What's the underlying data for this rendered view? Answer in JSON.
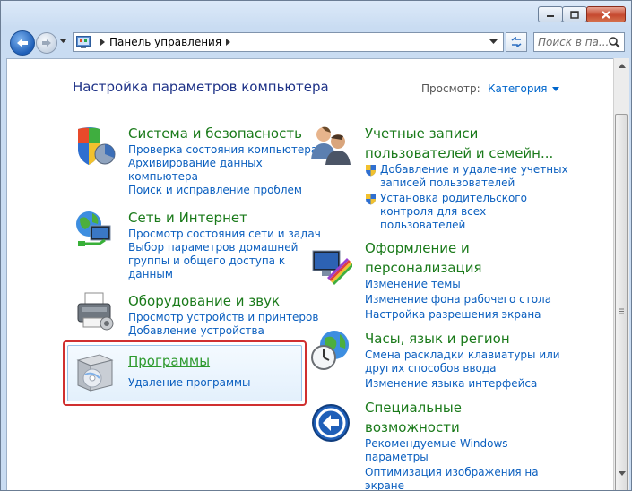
{
  "window": {
    "caption": {
      "minimize": "minimize",
      "maximize": "maximize",
      "close": "close"
    }
  },
  "toolbar": {
    "breadcrumb": "Панель управления",
    "search_placeholder": "Поиск в па..."
  },
  "header": {
    "title": "Настройка параметров компьютера",
    "view_by_label": "Просмотр:",
    "view_by_value": "Категория"
  },
  "left_categories": [
    {
      "title": "Система и безопасность",
      "links": [
        "Проверка состояния компьютера",
        "Архивирование данных",
        "компьютера",
        "Поиск и исправление проблем"
      ]
    },
    {
      "title": "Сеть и Интернет",
      "links": [
        "Просмотр состояния сети и задач",
        "Выбор параметров домашней",
        "группы и общего доступа к",
        "данным"
      ]
    },
    {
      "title": "Оборудование и звук",
      "links": [
        "Просмотр устройств и принтеров",
        "Добавление устройства"
      ]
    },
    {
      "title": "Программы",
      "links": [
        "Удаление программы"
      ]
    }
  ],
  "right_categories": [
    {
      "title_lines": [
        "Учетные записи",
        "пользователей и семейн..."
      ],
      "links": [
        "Добавление и удаление учетных",
        "записей пользователей",
        "Установка родительского",
        "контроля для всех",
        "пользователей"
      ]
    },
    {
      "title_lines": [
        "Оформление и",
        "персонализация"
      ],
      "links": [
        "Изменение темы",
        "Изменение фона рабочего стола",
        "Настройка разрешения экрана"
      ]
    },
    {
      "title_lines": [
        "Часы, язык и регион"
      ],
      "links": [
        "Смена раскладки клавиатуры или",
        "других способов ввода",
        "Изменение языка интерфейса"
      ]
    },
    {
      "title_lines": [
        "Специальные",
        "возможности"
      ],
      "links": [
        "Рекомендуемые Windows",
        "параметры",
        "Оптимизация изображения на",
        "экране"
      ]
    }
  ],
  "colors": {
    "link": "#0b5fbf",
    "category_title": "#1a7a1a",
    "page_title": "#1e3287",
    "highlight_border": "#d03030"
  }
}
